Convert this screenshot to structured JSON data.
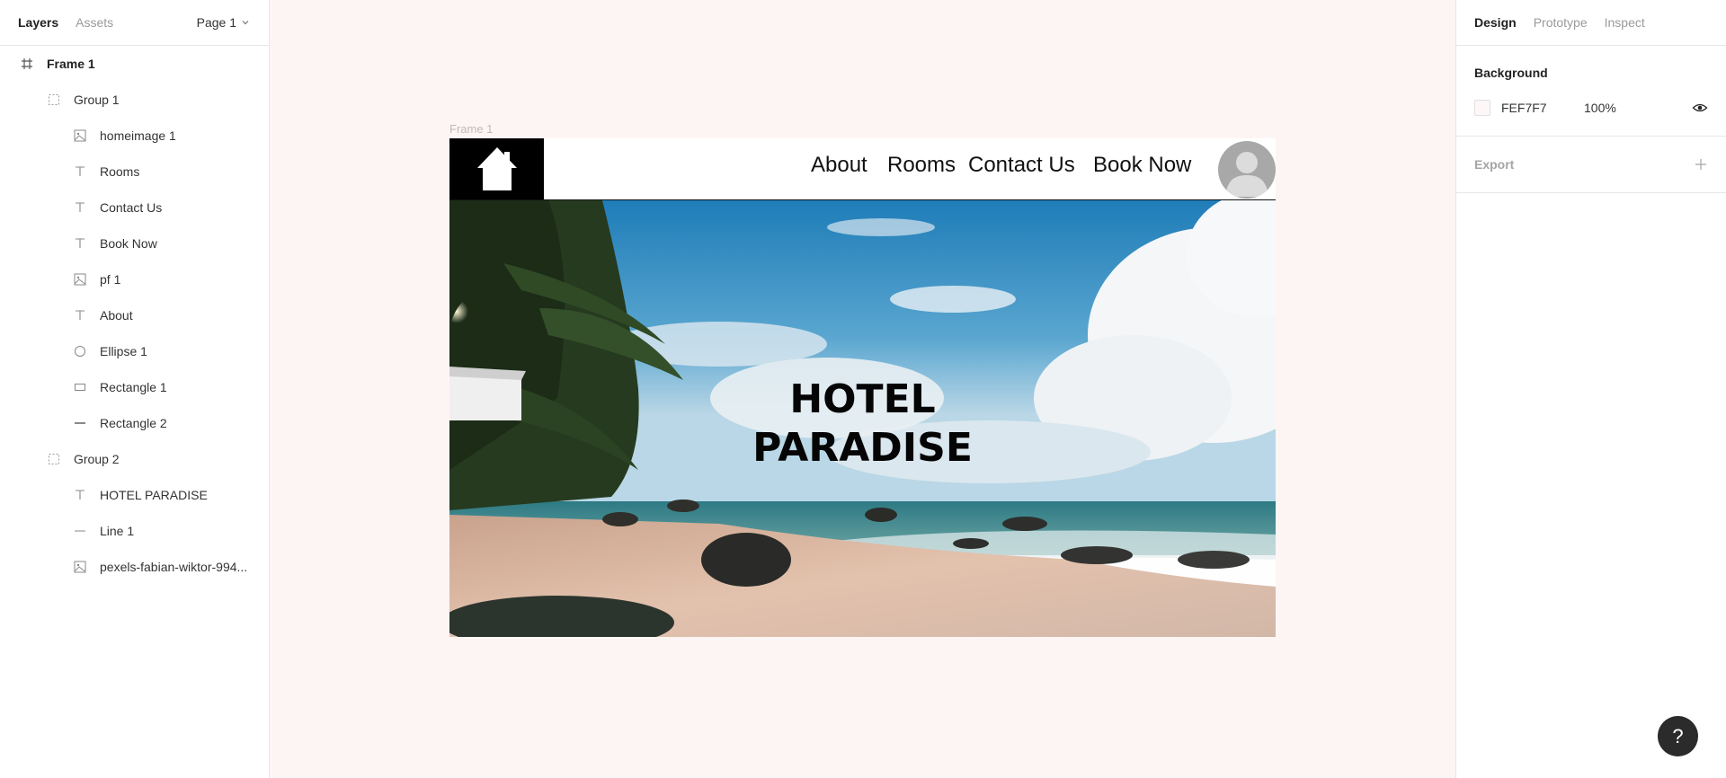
{
  "left_panel": {
    "tabs": [
      "Layers",
      "Assets"
    ],
    "page_selector": "Page 1",
    "layers": [
      {
        "label": "Frame 1",
        "icon": "frame-icon"
      },
      {
        "label": "Group 1",
        "icon": "group-icon"
      },
      {
        "label": "homeimage 1",
        "icon": "image-icon"
      },
      {
        "label": "Rooms",
        "icon": "text-icon"
      },
      {
        "label": "Contact Us",
        "icon": "text-icon"
      },
      {
        "label": "Book Now",
        "icon": "text-icon"
      },
      {
        "label": "pf 1",
        "icon": "image-icon"
      },
      {
        "label": "About",
        "icon": "text-icon"
      },
      {
        "label": "Ellipse 1",
        "icon": "ellipse-icon"
      },
      {
        "label": "Rectangle 1",
        "icon": "rectangle-icon"
      },
      {
        "label": "Rectangle 2",
        "icon": "line-icon"
      },
      {
        "label": "Group 2",
        "icon": "group-icon"
      },
      {
        "label": "HOTEL PARADISE",
        "icon": "text-icon"
      },
      {
        "label": "Line 1",
        "icon": "line-icon"
      },
      {
        "label": "pexels-fabian-wiktor-994...",
        "icon": "image-icon"
      }
    ]
  },
  "right_panel": {
    "tabs": [
      "Design",
      "Prototype",
      "Inspect"
    ],
    "background": {
      "title": "Background",
      "hex": "FEF7F7",
      "opacity": "100%"
    },
    "export": {
      "title": "Export"
    }
  },
  "canvas": {
    "frame_label": "Frame 1",
    "nav_links": [
      "About",
      "Rooms",
      "Contact Us",
      "Book Now"
    ],
    "hero_title_line1": "HOTEL",
    "hero_title_line2": "PARADISE"
  },
  "help": "?",
  "colors": {
    "canvas_bg": "#fdf5f4",
    "frame_background": "#FEF7F7",
    "logo_bg": "#000000",
    "help_button": "#2b2b2b"
  }
}
